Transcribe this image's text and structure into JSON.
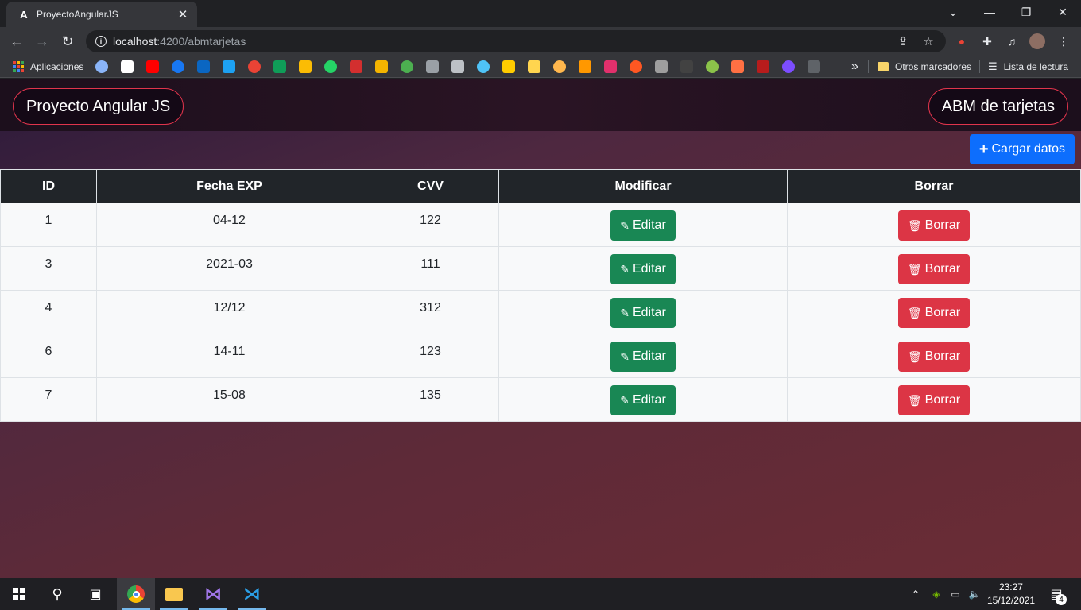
{
  "browser": {
    "tab_title": "ProyectoAngularJS",
    "tab_favicon": "A",
    "url_host": "localhost",
    "url_rest": ":4200/abmtarjetas",
    "window_controls": [
      "⌄",
      "—",
      "❐",
      "✕"
    ]
  },
  "bookmarks": {
    "apps_label": "Aplicaciones",
    "overflow": "»",
    "other_label": "Otros marcadores",
    "reading_label": "Lista de lectura",
    "icon_colors": [
      "#8ab4f8",
      "#ffffff",
      "#ff0000",
      "#1877f2",
      "#0a66c2",
      "#1da1f2",
      "#ea4335",
      "#0f9d58",
      "#fbbc04",
      "#25d366",
      "#d32f2f",
      "#f4b400",
      "#4caf50",
      "#9aa0a6",
      "#bdc1c6",
      "#4fc3f7",
      "#ffcc00",
      "#ffd54f",
      "#ffb74d",
      "#ff9800",
      "#e1306c",
      "#ff5722",
      "#9e9e9e",
      "#424242",
      "#8bc34a",
      "#ff7043",
      "#b71c1c",
      "#7c4dff",
      "#5f6368"
    ]
  },
  "header": {
    "left_title": "Proyecto Angular JS",
    "right_title": "ABM de tarjetas"
  },
  "actions": {
    "load_label": "Cargar datos"
  },
  "table": {
    "columns": [
      "ID",
      "Fecha EXP",
      "CVV",
      "Modificar",
      "Borrar"
    ],
    "edit_label": "Editar",
    "delete_label": "Borrar",
    "rows": [
      {
        "id": "1",
        "fecha": "04-12",
        "cvv": "122"
      },
      {
        "id": "3",
        "fecha": "2021-03",
        "cvv": "111"
      },
      {
        "id": "4",
        "fecha": "12/12",
        "cvv": "312"
      },
      {
        "id": "6",
        "fecha": "14-11",
        "cvv": "123"
      },
      {
        "id": "7",
        "fecha": "15-08",
        "cvv": "135"
      }
    ]
  },
  "taskbar": {
    "time": "23:27",
    "date": "15/12/2021",
    "notifications": "4"
  }
}
